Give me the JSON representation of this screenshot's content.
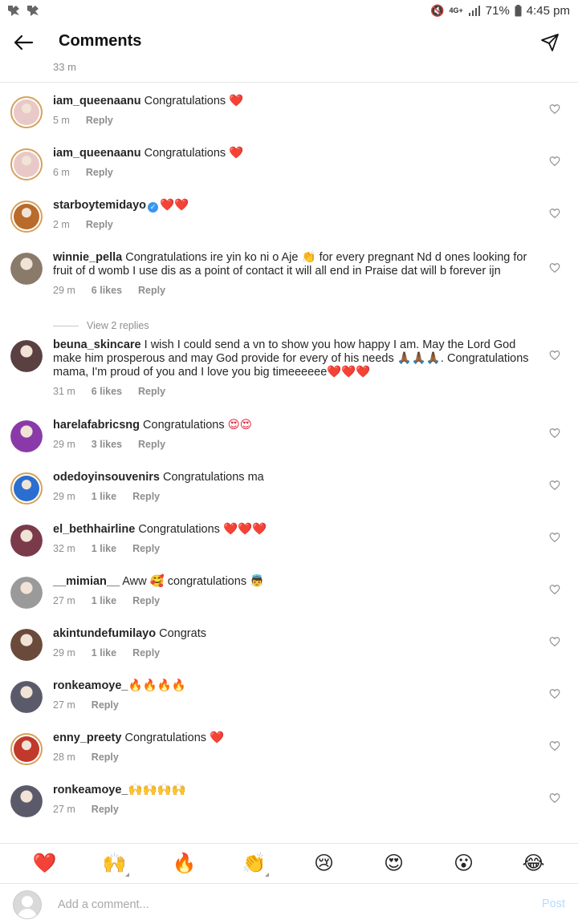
{
  "status_bar": {
    "left_icons": [
      "app-icon",
      "app-icon"
    ],
    "network": "4G+",
    "battery": "71%",
    "time": "4:45 pm"
  },
  "header": {
    "title": "Comments"
  },
  "previous_timestamp": "33 m",
  "comments": [
    {
      "user": "iam_queenaanu",
      "text": "Congratulations",
      "emoji": "❤️",
      "time": "5 m",
      "likes": "",
      "reply": "Reply",
      "verified": false,
      "avatar_color": "#e9c8c8",
      "ring": true
    },
    {
      "user": "iam_queenaanu",
      "text": "Congratulations",
      "emoji": "❤️",
      "time": "6 m",
      "likes": "",
      "reply": "Reply",
      "verified": false,
      "avatar_color": "#e9c8c8",
      "ring": true
    },
    {
      "user": "starboytemidayo",
      "text": "",
      "emoji": "❤️❤️",
      "time": "2 m",
      "likes": "",
      "reply": "Reply",
      "verified": true,
      "avatar_color": "#b86b2a",
      "ring": true
    },
    {
      "user": "winnie_pella",
      "text": "Congratulations ire yin ko ni o Aje 👏 for every pregnant Nd d ones looking for fruit of d womb I use dis as a point of contact it will all end in Praise dat will b forever ijn",
      "emoji": "",
      "time": "29 m",
      "likes": "6 likes",
      "reply": "Reply",
      "verified": false,
      "avatar_color": "#8a7a6a",
      "ring": false
    },
    {
      "user": "beuna_skincare",
      "text": "I wish I could send a vn to show you how happy I am.  May the Lord God make him prosperous and may God provide for every of his needs 🙏🏾🙏🏾🙏🏾. Congratulations mama, I'm proud of you and I love you big timeeeeee",
      "emoji": "❤️❤️❤️",
      "time": "31 m",
      "likes": "6 likes",
      "reply": "Reply",
      "verified": false,
      "avatar_color": "#5a4040",
      "ring": false
    },
    {
      "user": "harelafabricsng",
      "text": "Congratulations",
      "emoji": "😍😍",
      "time": "29 m",
      "likes": "3 likes",
      "reply": "Reply",
      "verified": false,
      "avatar_color": "#8a3aa8",
      "ring": false
    },
    {
      "user": "odedoyinsouvenirs",
      "text": "Congratulations ma",
      "emoji": "",
      "time": "29 m",
      "likes": "1 like",
      "reply": "Reply",
      "verified": false,
      "avatar_color": "#2a6fcf",
      "ring": true
    },
    {
      "user": "el_bethhairline",
      "text": "Congratulations",
      "emoji": "❤️❤️❤️",
      "time": "32 m",
      "likes": "1 like",
      "reply": "Reply",
      "verified": false,
      "avatar_color": "#7a3a4a",
      "ring": false
    },
    {
      "user": "__mimian__",
      "text": "Aww 🥰 congratulations",
      "emoji": "👼",
      "time": "27 m",
      "likes": "1 like",
      "reply": "Reply",
      "verified": false,
      "avatar_color": "#9a9a9a",
      "ring": false
    },
    {
      "user": "akintundefumilayo",
      "text": "Congrats",
      "emoji": "",
      "time": "29 m",
      "likes": "1 like",
      "reply": "Reply",
      "verified": false,
      "avatar_color": "#6a4a3a",
      "ring": false
    },
    {
      "user": "ronkeamoye_",
      "text": "",
      "emoji": "🔥🔥🔥🔥",
      "time": "27 m",
      "likes": "",
      "reply": "Reply",
      "verified": false,
      "avatar_color": "#5a5a6a",
      "ring": false
    },
    {
      "user": "enny_preety",
      "text": "Congratulations",
      "emoji": "❤️",
      "time": "28 m",
      "likes": "",
      "reply": "Reply",
      "verified": false,
      "avatar_color": "#c0392b",
      "ring": true
    },
    {
      "user": "ronkeamoye_",
      "text": "",
      "emoji": "🙌🙌🙌🙌",
      "time": "27 m",
      "likes": "",
      "reply": "Reply",
      "verified": false,
      "avatar_color": "#5a5a6a",
      "ring": false
    }
  ],
  "view_replies": "View 2 replies",
  "emoji_bar": [
    "❤️",
    "🙌",
    "🔥",
    "👏",
    "😢",
    "😍",
    "😮",
    "😂"
  ],
  "add_comment": {
    "placeholder": "Add a comment...",
    "post_label": "Post"
  },
  "colors": {
    "heart_red": "#e0243a",
    "muted_text": "#8e8e8e",
    "post_disabled": "#b3dbff"
  }
}
